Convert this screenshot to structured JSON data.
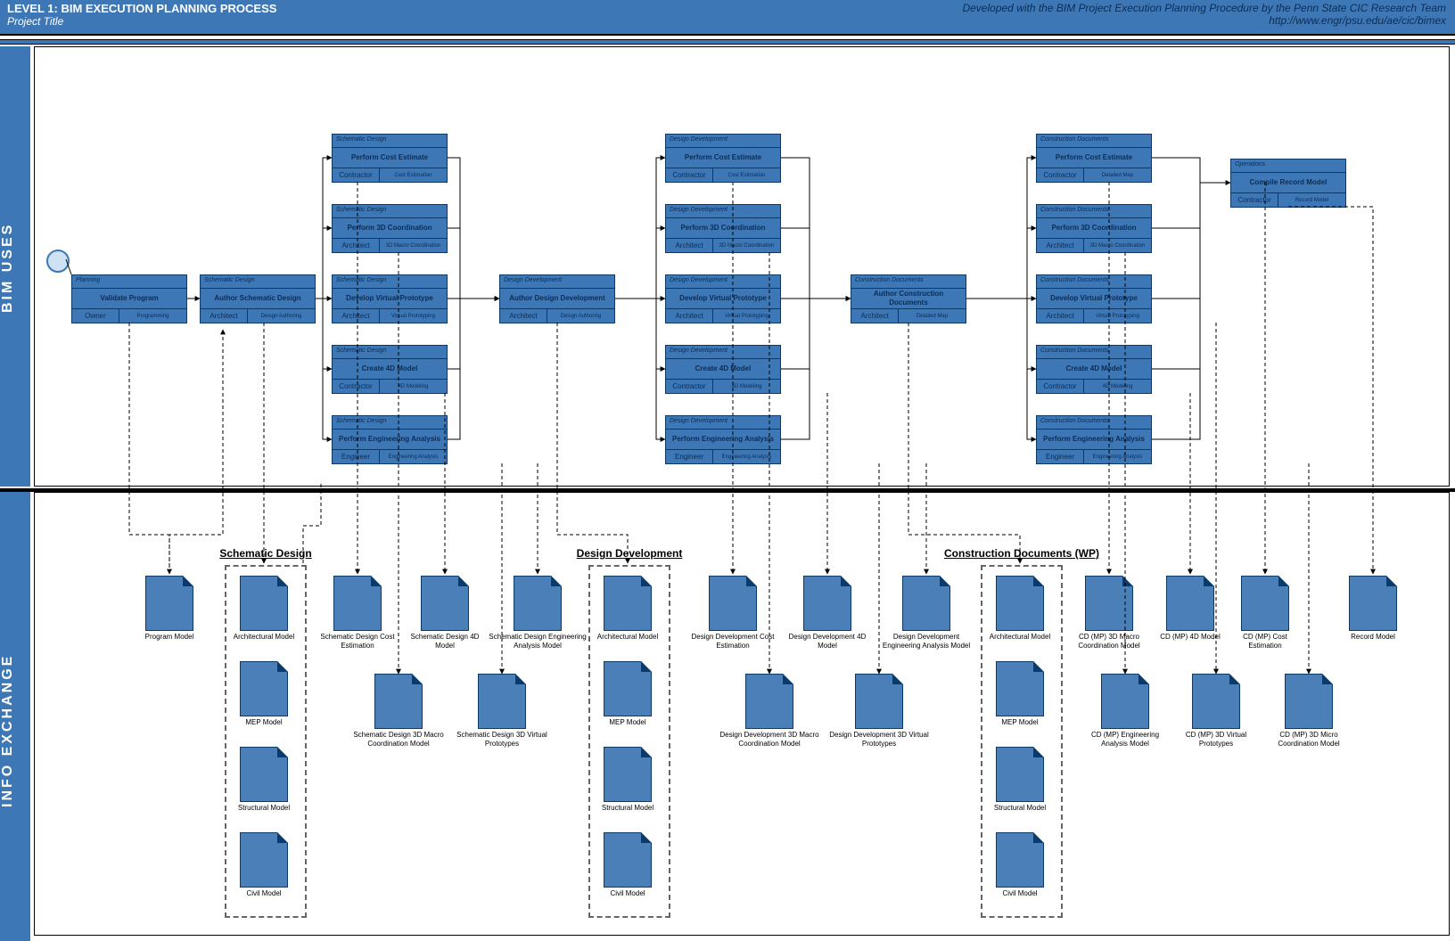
{
  "header": {
    "title": "LEVEL 1:  BIM EXECUTION PLANNING PROCESS",
    "subtitle": "Project Title",
    "credit1": "Developed with the BIM Project Execution Planning Procedure by the Penn State CIC Research Team",
    "credit2": "http://www.engr/psu.edu/ae/cic/bimex"
  },
  "lanes": {
    "top": "BIM  USES",
    "bottom": "INFO  EXCHANGE"
  },
  "nodes": {
    "planning": {
      "phase": "Planning",
      "name": "Validate  Program",
      "role": "Owner",
      "tool": "Programming"
    },
    "authSD": {
      "phase": "Schematic Design",
      "name": "Author Schematic Design",
      "role": "Architect",
      "tool": "Design Authoring"
    },
    "sd_cost": {
      "phase": "Schematic Design",
      "name": "Perform Cost Estimate",
      "role": "Contractor",
      "tool": "Cost Estimation"
    },
    "sd_3d": {
      "phase": "Schematic Design",
      "name": "Perform 3D Coordination",
      "role": "Architect",
      "tool": "3D Macro Coordination"
    },
    "sd_vp": {
      "phase": "Schematic Design",
      "name": "Develop Virtual Prototype",
      "role": "Architect",
      "tool": "Virtual Prototyping"
    },
    "sd_4d": {
      "phase": "Schematic Design",
      "name": "Create 4D Model",
      "role": "Contractor",
      "tool": "4D Modeling"
    },
    "sd_eng": {
      "phase": "Schematic Design",
      "name": "Perform Engineering Analysis",
      "role": "Engineer",
      "tool": "Engineering Analysis"
    },
    "authDD": {
      "phase": "Design Development",
      "name": "Author Design Development",
      "role": "Architect",
      "tool": "Design Authoring"
    },
    "dd_cost": {
      "phase": "Design Development",
      "name": "Perform Cost Estimate",
      "role": "Contractor",
      "tool": "Cost Estimation"
    },
    "dd_3d": {
      "phase": "Design Development",
      "name": "Perform 3D Coordination",
      "role": "Architect",
      "tool": "3D Macro Coordination"
    },
    "dd_vp": {
      "phase": "Design Development",
      "name": "Develop Virtual Prototype",
      "role": "Architect",
      "tool": "Virtual Prototyping"
    },
    "dd_4d": {
      "phase": "Design Development",
      "name": "Create 4D Model",
      "role": "Contractor",
      "tool": "4D Modeling"
    },
    "dd_eng": {
      "phase": "Design Development",
      "name": "Perform Engineering Analysis",
      "role": "Engineer",
      "tool": "Engineering Analysis"
    },
    "authCD": {
      "phase": "Construction Documents",
      "name": "Author Construction Documents",
      "role": "Architect",
      "tool": "Detailed Mep"
    },
    "cd_cost": {
      "phase": "Construction Documents",
      "name": "Perform Cost Estimate",
      "role": "Contractor",
      "tool": "Detailed Mep"
    },
    "cd_3d": {
      "phase": "Construction Documents",
      "name": "Perform 3D Coordination",
      "role": "Architect",
      "tool": "3D Macro Coordination"
    },
    "cd_vp": {
      "phase": "Construction Documents",
      "name": "Develop Virtual Prototype",
      "role": "Architect",
      "tool": "Virtual Prototyping"
    },
    "cd_4d": {
      "phase": "Construction Documents",
      "name": "Create 4D Model",
      "role": "Contractor",
      "tool": "4D Modeling"
    },
    "cd_eng": {
      "phase": "Construction Documents",
      "name": "Perform Engineering Analysis",
      "role": "Engineer",
      "tool": "Engineering Analysis"
    },
    "ops_record": {
      "phase": "Operations",
      "name": "Compile Record Model",
      "role": "Contractor",
      "tool": "Record Model"
    }
  },
  "groups": {
    "sd": "Schematic Design",
    "dd": "Design Development",
    "cd": "Construction Documents (WP)"
  },
  "docs": {
    "program": "Program Model",
    "sd_arch": "Architectural Model",
    "sd_mep": "MEP Model",
    "sd_struct": "Structural Model",
    "sd_civil": "Civil Model",
    "sd_cost": "Schematic Design Cost Estimation",
    "sd_4d": "Schematic Design 4D Model",
    "sd_engm": "Schematic Design Engineering Analysis Model",
    "sd_3dmacro": "Schematic Design 3D Macro Coordination Model",
    "sd_3dvp": "Schematic Design 3D Virtual Prototypes",
    "dd_arch": "Architectural Model",
    "dd_mep": "MEP Model",
    "dd_struct": "Structural Model",
    "dd_civil": "Civil Model",
    "dd_cost": "Design Development Cost Estimation",
    "dd_4d": "Design Development 4D Model",
    "dd_engm": "Design Development Engineering Analysis Model",
    "dd_3dmacro": "Design Development 3D Macro Coordination Model",
    "dd_3dvp": "Design Development 3D Virtual Prototypes",
    "cd_arch": "Architectural Model",
    "cd_mep": "MEP Model",
    "cd_struct": "Structural Model",
    "cd_civil": "Civil Model",
    "cd_3dmacro": "CD (MP) 3D Macro Coordination Model",
    "cd_4d": "CD (MP) 4D Model",
    "cd_cost": "CD (MP) Cost Estimation",
    "cd_engm": "CD (MP) Engineering Analysis Model",
    "cd_3dvp": "CD (MP) 3D Virtual Prototypes",
    "cd_3dmicro": "CD (MP) 3D Micro Coordination Model",
    "record": "Record Model"
  }
}
